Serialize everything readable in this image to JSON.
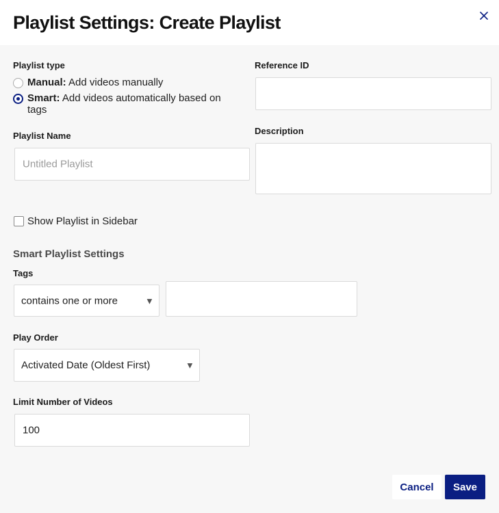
{
  "dialog": {
    "title": "Playlist Settings: Create Playlist",
    "close_icon": "close-x-icon"
  },
  "playlist_type": {
    "label": "Playlist type",
    "options": [
      {
        "bold": "Manual:",
        "text": "Add videos manually",
        "selected": false
      },
      {
        "bold": "Smart:",
        "text": "Add videos automatically based on tags",
        "selected": true
      }
    ]
  },
  "reference_id": {
    "label": "Reference ID",
    "value": ""
  },
  "playlist_name": {
    "label": "Playlist Name",
    "placeholder": "Untitled Playlist",
    "value": ""
  },
  "description": {
    "label": "Description",
    "value": ""
  },
  "sidebar_option": {
    "label": "Show Playlist in Sidebar",
    "checked": false
  },
  "smart_settings": {
    "heading": "Smart Playlist Settings",
    "tags": {
      "label": "Tags",
      "operator": "contains one or more",
      "value": ""
    },
    "play_order": {
      "label": "Play Order",
      "selected": "Activated Date (Oldest First)"
    },
    "limit": {
      "label": "Limit Number of Videos",
      "value": "100"
    }
  },
  "actions": {
    "cancel": "Cancel",
    "save": "Save"
  },
  "colors": {
    "accent": "#0a1e82",
    "background": "#f7f7f7",
    "header": "#ffffff"
  },
  "icons": {
    "dropdown": "caret-down-icon"
  }
}
